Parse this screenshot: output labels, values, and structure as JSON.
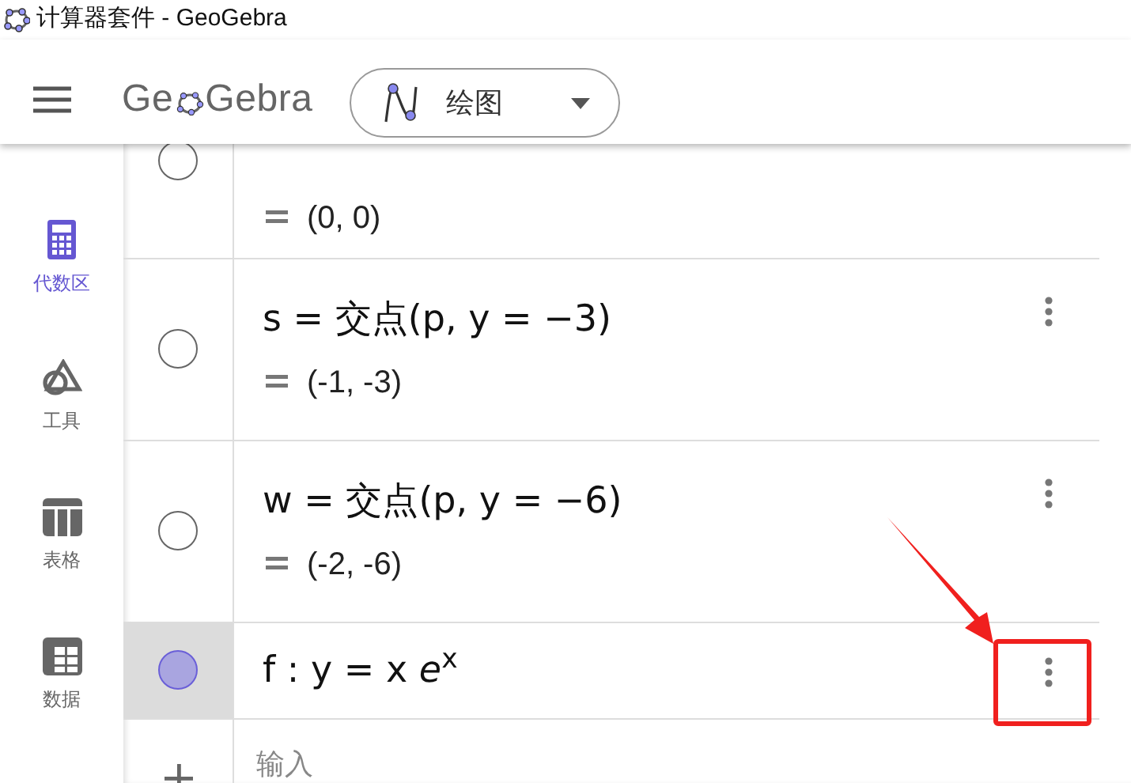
{
  "window": {
    "title": "计算器套件 - GeoGebra"
  },
  "header": {
    "logo_start": "Ge",
    "logo_end": "Gebra",
    "app_picker": {
      "label": "绘图"
    }
  },
  "sidebar": {
    "items": [
      {
        "label": "代数区",
        "kind": "algebra",
        "selected": true
      },
      {
        "label": "工具",
        "kind": "tools",
        "selected": false
      },
      {
        "label": "表格",
        "kind": "table",
        "selected": false
      },
      {
        "label": "数据",
        "kind": "data",
        "selected": false
      }
    ]
  },
  "algebra": {
    "items": [
      {
        "kind": "partial",
        "value": "(0, 0)",
        "visible": false,
        "selected": false,
        "highlighted": false
      },
      {
        "kind": "full",
        "definition": "s = 交点(p, y = −3)",
        "value": "(-1, -3)",
        "visible": false,
        "selected": false,
        "highlighted": false
      },
      {
        "kind": "full",
        "definition": "w = 交点(p, y = −6)",
        "value": "(-2, -6)",
        "visible": false,
        "selected": false,
        "highlighted": false
      },
      {
        "kind": "single",
        "definition": "f : y = x *e*$^{x}$",
        "visible": true,
        "color": "#a9a5e0",
        "selected": true,
        "highlighted": true
      }
    ],
    "input": {
      "placeholder": "输入"
    }
  }
}
